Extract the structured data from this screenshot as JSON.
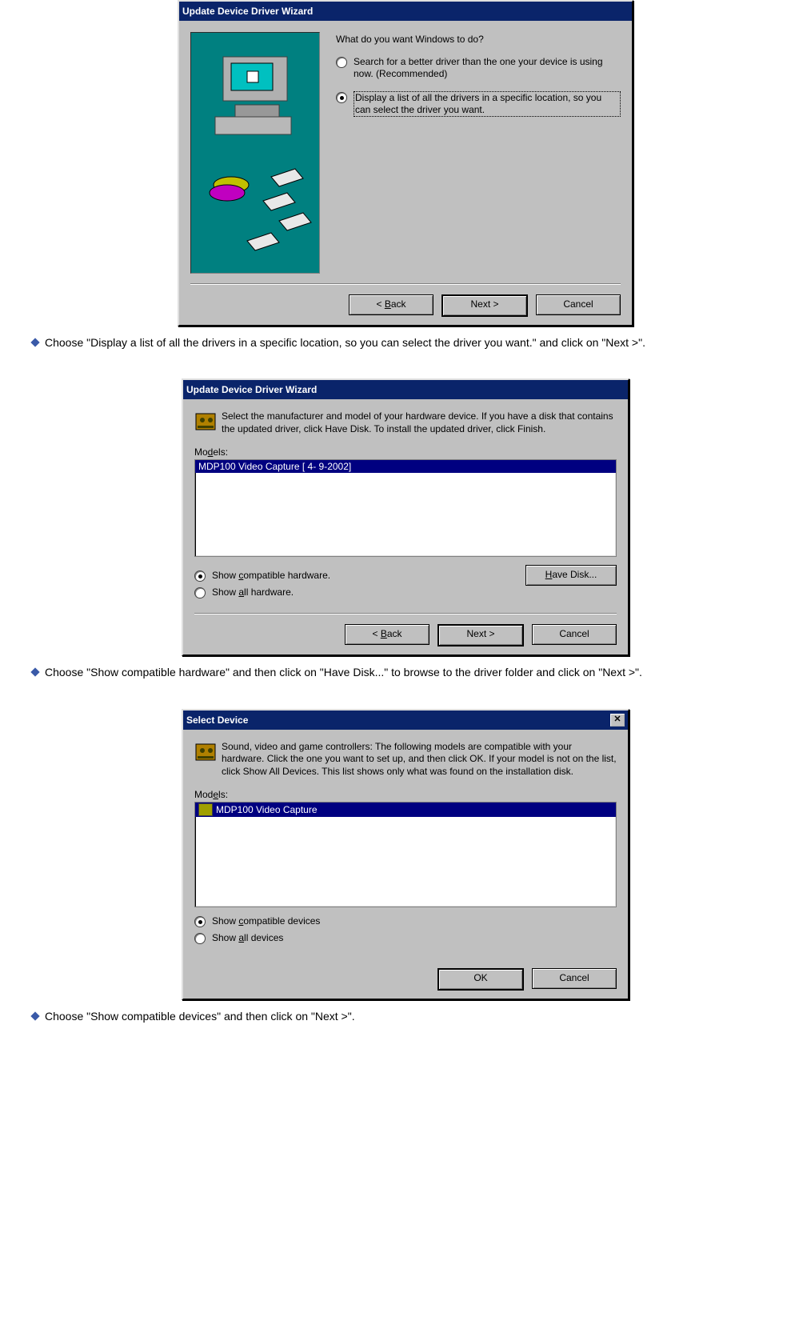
{
  "dialog1": {
    "title": "Update Device Driver Wizard",
    "question": "What do you want Windows to do?",
    "opt1": "Search for a better driver than the one your device is using now. (Recommended)",
    "opt2": "Display a list of all the drivers in a specific location, so you can select the driver you want.",
    "back": "< Back",
    "next": "Next >",
    "cancel": "Cancel"
  },
  "caption1": "Choose \"Display a list of all the drivers in a specific location, so you can select the driver you want.\" and click on \"Next >\".",
  "dialog2": {
    "title": "Update Device Driver Wizard",
    "intro": "Select the manufacturer and model of your hardware device. If you have a disk that contains the updated driver, click Have Disk. To install the updated driver, click Finish.",
    "models_label": "Models:",
    "model_item": "MDP100 Video Capture [ 4- 9-2002]",
    "opt1": "Show compatible hardware.",
    "opt2": "Show all hardware.",
    "have_disk": "Have Disk...",
    "back": "< Back",
    "next": "Next >",
    "cancel": "Cancel"
  },
  "caption2": "Choose \"Show compatible hardware\" and then click on \"Have Disk...\" to browse to the driver folder and click on \"Next >\".",
  "dialog3": {
    "title": "Select Device",
    "intro": "Sound, video and game controllers: The following models are compatible with your hardware. Click the one you want to set up, and then click OK. If your model is not on the list, click Show All Devices. This list shows only what was found on the installation disk.",
    "models_label": "Models:",
    "model_item": "MDP100 Video Capture",
    "opt1": "Show compatible devices",
    "opt2": "Show all devices",
    "ok": "OK",
    "cancel": "Cancel"
  },
  "caption3": "Choose \"Show compatible devices\" and then click on \"Next >\"."
}
